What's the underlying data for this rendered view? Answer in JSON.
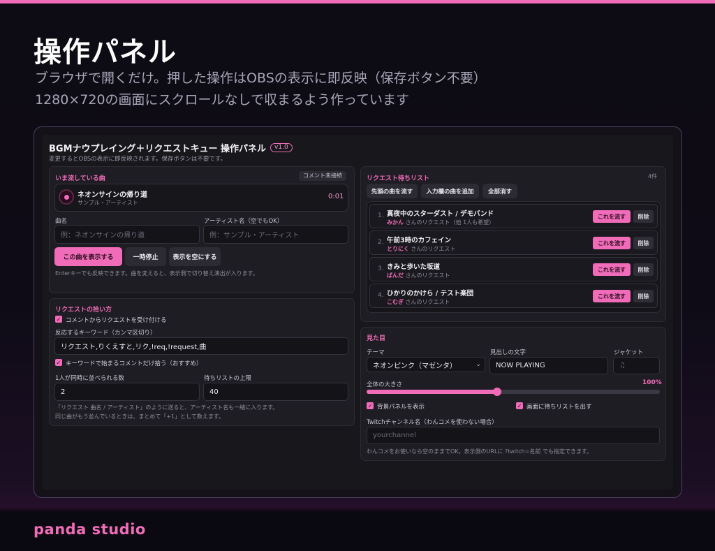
{
  "hero": {
    "title": "操作パネル",
    "sub1": "ブラウザで開くだけ。押した操作はOBSの表示に即反映（保存ボタン不要）",
    "sub2": "1280×720の画面にスクロールなしで収まるよう作っています"
  },
  "panel": {
    "title": "BGMナウプレイング＋リクエストキュー 操作パネル",
    "version": "v1.0",
    "subtitle": "変更するとOBSの表示に即反映されます。保存ボタンは不要です。"
  },
  "now_playing": {
    "title": "いま流している曲",
    "status": "コメント未接続",
    "song": "ネオンサインの帰り道",
    "artist": "サンプル・アーティスト",
    "time": "0:01",
    "song_label": "曲名",
    "song_placeholder": "例：ネオンサインの帰り道",
    "artist_label": "アーティスト名（空でもOK）",
    "artist_placeholder": "例：サンプル・アーティスト",
    "show_button": "この曲を表示する",
    "pause_button": "一時停止",
    "clear_button": "表示を空にする",
    "note": "Enterキーでも反映できます。曲を変えると、表示側で切り替え演出が入ります。"
  },
  "request_settings": {
    "title": "リクエストの拾い方",
    "accept_label": "コメントからリクエストを受け付ける",
    "accept_checked": true,
    "keywords_label": "反応するキーワード（カンマ区切り）",
    "keywords_value": "リクエスト,りくえすと,リク,!req,!request,曲",
    "prefix_label": "キーワードで始まるコメントだけ拾う（おすすめ）",
    "prefix_checked": true,
    "per_user_label": "1人が同時に並べられる数",
    "per_user_value": "2",
    "max_label": "待ちリストの上限",
    "max_value": "40",
    "note1": "「リクエスト 曲名 / アーティスト」のように送ると、アーティスト名も一緒に入ります。",
    "note2": "同じ曲がもう並んでいるときは、まとめて「+1」として数えます。"
  },
  "queue": {
    "title": "リクエスト待ちリスト",
    "count": "4件",
    "play_first": "先頭の曲を流す",
    "add_input": "入力欄の曲を追加",
    "clear_all": "全部消す",
    "play_label": "これを流す",
    "delete_label": "削除",
    "items": [
      {
        "num": "1.",
        "title": "真夜中のスターダスト / デモバンド",
        "user": "みかん",
        "meta": " さんのリクエスト（他 1人も希望）"
      },
      {
        "num": "2.",
        "title": "午前3時のカフェイン",
        "user": "とりにく",
        "meta": " さんのリクエスト"
      },
      {
        "num": "3.",
        "title": "きみと歩いた坂道",
        "user": "ぱんだ",
        "meta": " さんのリクエスト"
      },
      {
        "num": "4.",
        "title": "ひかりのかけら / テスト楽団",
        "user": "こむぎ",
        "meta": " さんのリクエスト"
      }
    ]
  },
  "appearance": {
    "title": "見た目",
    "theme_label": "テーマ",
    "theme_value": "ネオンピンク（マゼンタ）",
    "heading_label": "見出しの文字",
    "heading_value": "NOW PLAYING",
    "jacket_label": "ジャケット",
    "jacket_icon": "♫",
    "size_label": "全体の大きさ",
    "size_value": "100%",
    "size_fraction": 0.45,
    "bg_panel_label": "背景パネルを表示",
    "bg_panel_checked": true,
    "show_queue_label": "画面に待ちリストを出す",
    "show_queue_checked": true,
    "twitch_label": "Twitchチャンネル名（わんコメを使わない場合）",
    "twitch_placeholder": "yourchannel",
    "note": "わんコメをお使いなら空のままでOK。表示側のURLに ?twitch=名前 でも指定できます。"
  },
  "footer": {
    "brand": "panda studio"
  },
  "colors": {
    "accent": "#f06cb8",
    "bg": "#0d0b14"
  }
}
